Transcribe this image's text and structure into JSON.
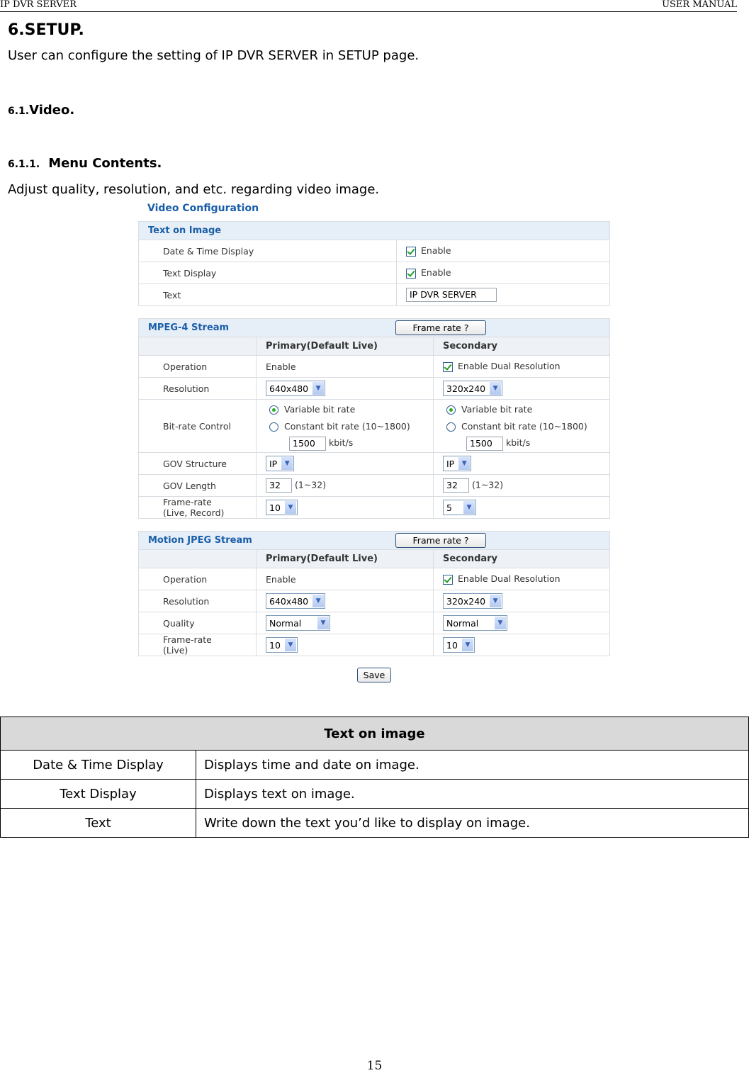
{
  "header": {
    "left": "IP DVR SERVER",
    "right": "USER MANUAL"
  },
  "section": {
    "title": "6.SETUP.",
    "intro": "User can configure the setting of IP DVR SERVER in SETUP page."
  },
  "subsection": {
    "num": "6.1.",
    "title": "Video."
  },
  "subsubsection": {
    "num": "6.1.1.",
    "title": "Menu Contents.",
    "intro": "Adjust quality, resolution, and etc. regarding video image."
  },
  "screenshot": {
    "title": "Video Configuration",
    "text_on_image": {
      "heading": "Text on Image",
      "rows": [
        {
          "label": "Date & Time Display",
          "checkbox_label": "Enable",
          "checked": true
        },
        {
          "label": "Text Display",
          "checkbox_label": "Enable",
          "checked": true
        },
        {
          "label": "Text",
          "value": "IP DVR SERVER"
        }
      ]
    },
    "mpeg4": {
      "heading": "MPEG-4 Stream",
      "frame_rate_button": "Frame rate ?",
      "col_primary": "Primary(Default Live)",
      "col_secondary": "Secondary",
      "operation": {
        "label": "Operation",
        "primary": "Enable",
        "secondary": "Enable Dual Resolution",
        "secondary_checked": true
      },
      "resolution": {
        "label": "Resolution",
        "primary": "640x480",
        "secondary": "320x240"
      },
      "bitrate": {
        "label": "Bit-rate Control",
        "variable": "Variable bit rate",
        "constant": "Constant bit rate (10~1800)",
        "primary_value": "1500",
        "secondary_value": "1500",
        "unit": "kbit/s",
        "selected": "variable"
      },
      "gov_structure": {
        "label": "GOV Structure",
        "primary": "IP",
        "secondary": "IP"
      },
      "gov_length": {
        "label": "GOV Length",
        "primary": "32",
        "secondary": "32",
        "range": "(1~32)"
      },
      "frame_rate": {
        "label_line1": "Frame-rate",
        "label_line2": "(Live, Record)",
        "primary": "10",
        "secondary": "5"
      }
    },
    "mjpeg": {
      "heading": "Motion JPEG Stream",
      "frame_rate_button": "Frame rate ?",
      "col_primary": "Primary(Default Live)",
      "col_secondary": "Secondary",
      "operation": {
        "label": "Operation",
        "primary": "Enable",
        "secondary": "Enable Dual Resolution",
        "secondary_checked": true
      },
      "resolution": {
        "label": "Resolution",
        "primary": "640x480",
        "secondary": "320x240"
      },
      "quality": {
        "label": "Quality",
        "primary": "Normal",
        "secondary": "Normal"
      },
      "frame_rate": {
        "label_line1": "Frame-rate",
        "label_line2": "(Live)",
        "primary": "10",
        "secondary": "10"
      }
    },
    "save_button": "Save"
  },
  "desc_table": {
    "heading": "Text on image",
    "rows": [
      {
        "key": "Date & Time Display",
        "desc": "Displays time and date on image."
      },
      {
        "key": "Text Display",
        "desc": "Displays text on image."
      },
      {
        "key": "Text",
        "desc": "Write down the text you’d like to display on image."
      }
    ]
  },
  "page_number": "15"
}
